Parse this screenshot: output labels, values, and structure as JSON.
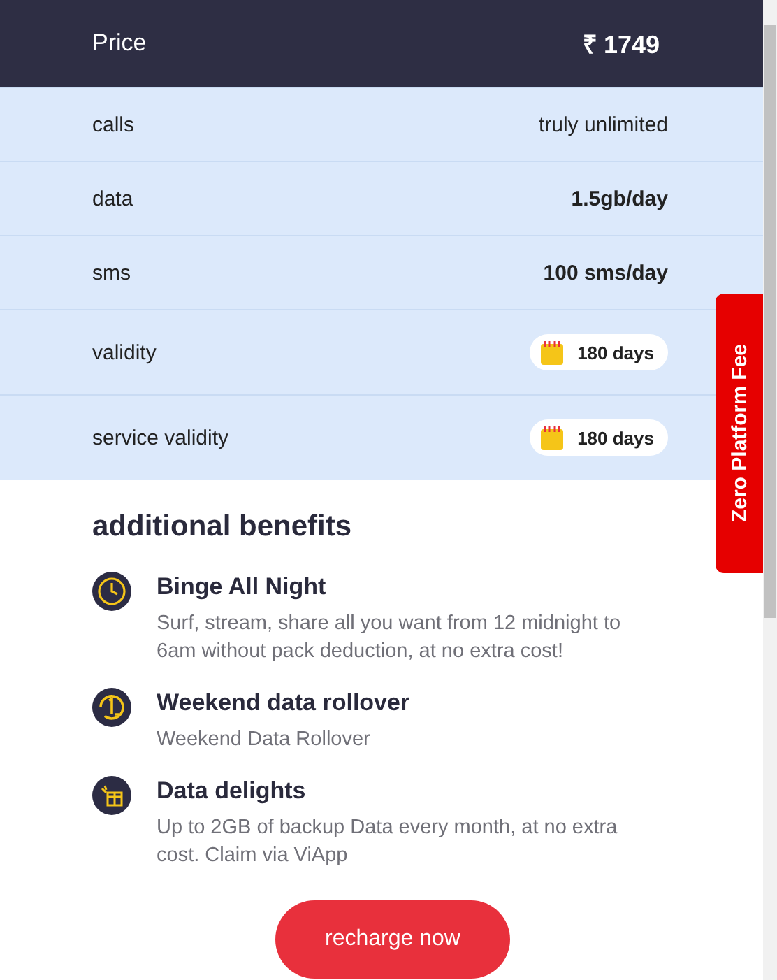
{
  "price": {
    "label": "Price",
    "value": "₹ 1749"
  },
  "specs": [
    {
      "label": "calls",
      "kind": "plain",
      "value": "truly unlimited"
    },
    {
      "label": "data",
      "kind": "bold",
      "value": "1.5gb/day"
    },
    {
      "label": "sms",
      "kind": "bold",
      "value": "100 sms/day"
    },
    {
      "label": "validity",
      "kind": "badge",
      "value": "180 days"
    },
    {
      "label": "service validity",
      "kind": "badge",
      "value": "180 days"
    }
  ],
  "benefits_title": "additional benefits",
  "benefits": [
    {
      "kind": "clock",
      "title": "Binge All Night",
      "description": "Surf, stream, share all you want from 12 midnight to 6am without pack deduction, at no extra cost!"
    },
    {
      "kind": "rollover",
      "title": "Weekend data rollover",
      "description": "Weekend Data Rollover"
    },
    {
      "kind": "gift",
      "title": "Data delights",
      "description": "Up to 2GB of backup Data every month, at no extra cost. Claim via ViApp"
    }
  ],
  "side_tab": "Zero Platform Fee",
  "cta": "recharge now"
}
